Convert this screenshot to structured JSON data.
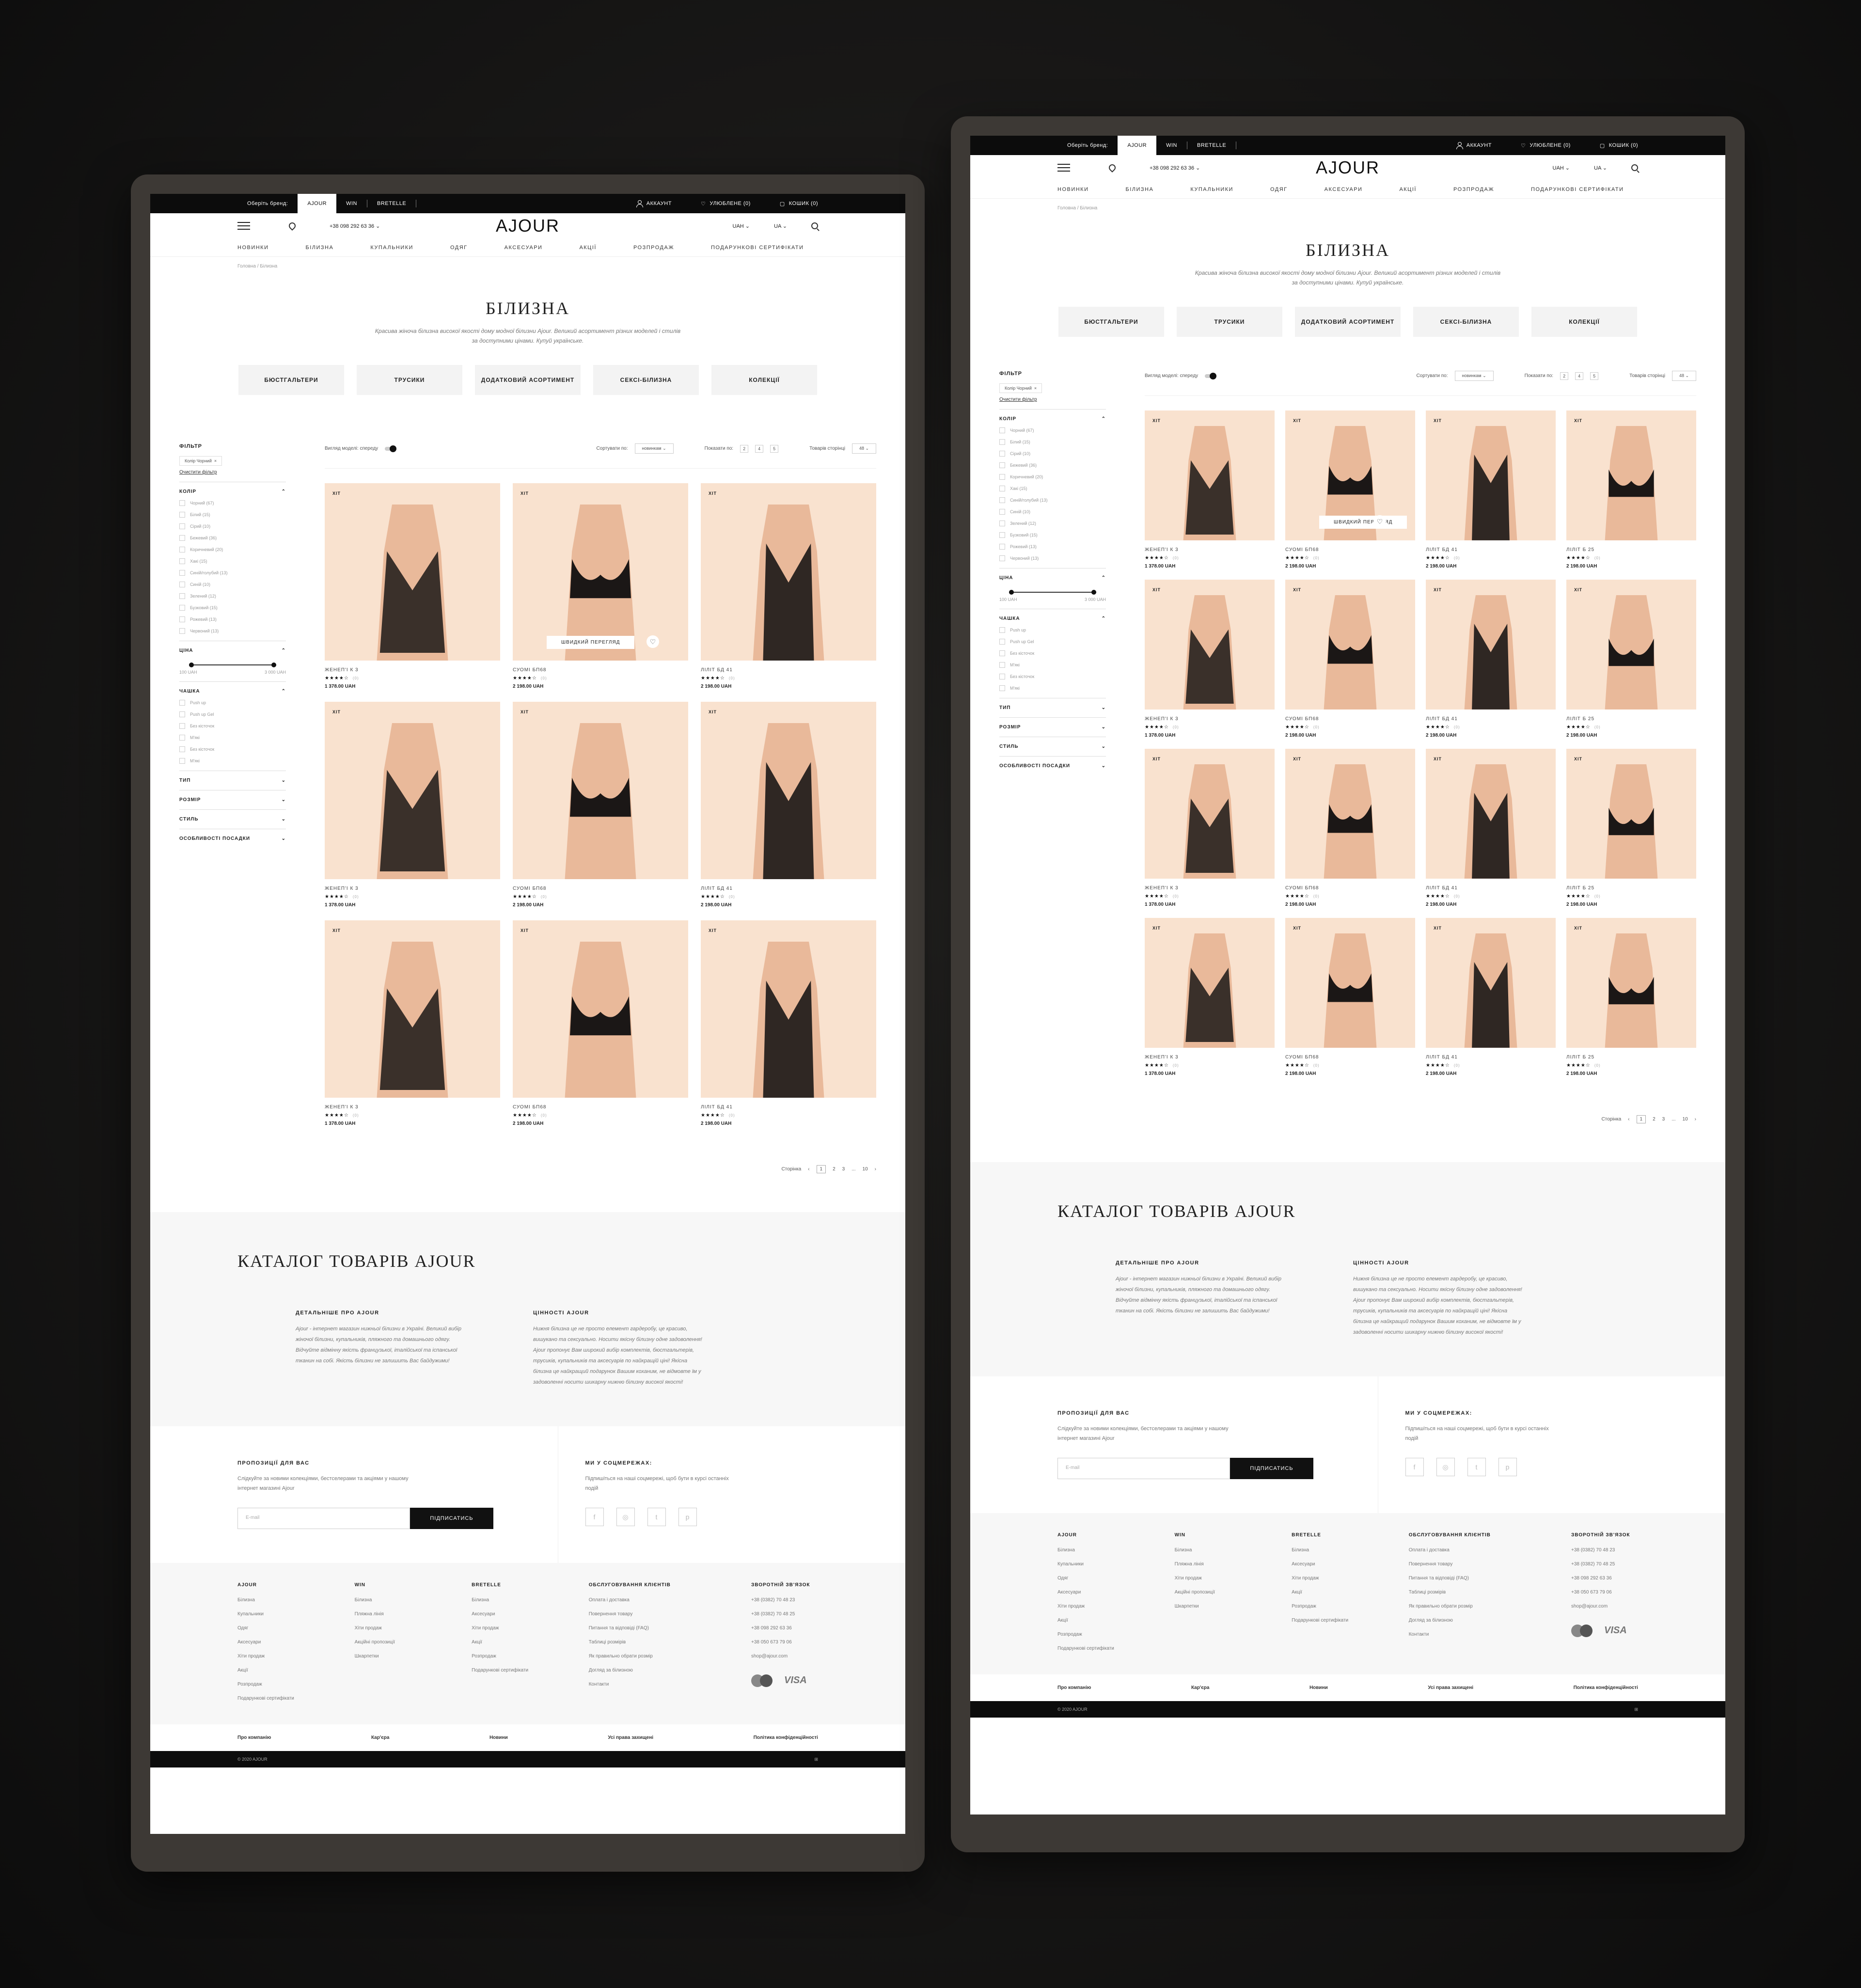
{
  "topbar": {
    "choose_brand": "Оберіть бренд:",
    "brands": [
      "AJOUR",
      "WIN",
      "BRETELLE"
    ],
    "account": "АККАУНТ",
    "favorites": "УЛЮБЛЕНЕ (0)",
    "cart": "КОШИК (0)"
  },
  "header": {
    "phone": "+38 098 292 63 36",
    "logo": "AJOUR",
    "currency": "UAH",
    "lang": "UA"
  },
  "nav": [
    "НОВИНКИ",
    "БІЛИЗНА",
    "КУПАЛЬНИКИ",
    "ОДЯГ",
    "АКСЕСУАРИ",
    "АКЦІЇ",
    "РОЗПРОДАЖ",
    "ПОДАРУНКОВІ СЕРТИФІКАТИ"
  ],
  "breadcrumb": "Головна / Білизна",
  "page": {
    "title": "БІЛИЗНА",
    "subtitle": "Красива жіноча білизна високої якості дому модної білизни Ajour. Великий асортимент різних моделей і стилів за доступними цінами. Купуй українське."
  },
  "categories": [
    "БЮСТГАЛЬТЕРИ",
    "ТРУСИКИ",
    "ДОДАТКОВИЙ АСОРТИМЕНТ",
    "СЕКСІ-БІЛИЗНА",
    "КОЛЕКЦІЇ"
  ],
  "filter": {
    "title": "ФІЛЬТР",
    "chip": "Колір Чорний",
    "clear": "Очистити фільтр",
    "color_title": "КОЛІР",
    "colors": [
      "Чорний (67)",
      "Білий (15)",
      "Сірий (10)",
      "Бежевий (36)",
      "Коричневий (20)",
      "Хакі (15)",
      "Синій/голубий (13)",
      "Синій (10)",
      "Зелений (12)",
      "Бузковий (15)",
      "Рожевий (13)",
      "Червоний (13)"
    ],
    "price_title": "ЦІНА",
    "price_min": "100 UAH",
    "price_max": "3 000 UAH",
    "cup_title": "ЧАШКА",
    "cups": [
      "Push up",
      "Push up Gel",
      "Без кісточок",
      "М'які",
      "Без кісточок",
      "М'які"
    ],
    "more": [
      "ТИП",
      "РОЗМІР",
      "СТИЛЬ",
      "ОСОБЛИВОСТІ ПОСАДКИ"
    ]
  },
  "toolbar": {
    "view": "Вигляд моделі: спереду",
    "sort_label": "Сортувати по:",
    "sort_value": "новинкам",
    "show_label": "Показати по:",
    "show_options": [
      "2",
      "4",
      "5"
    ],
    "per_page_label": "Товарів сторінці",
    "per_page_value": "48"
  },
  "product_common": {
    "badge": "ХІТ",
    "quick_view": "ШВИДКИЙ ПЕРЕГЛЯД"
  },
  "products": [
    {
      "name": "ЖЕНЕП'І К 3",
      "stars": "★★★★☆",
      "reviews": "(0)",
      "price": "1 378.00 UAH"
    },
    {
      "name": "СУОМІ БП68",
      "stars": "★★★★☆",
      "reviews": "(0)",
      "price": "2 198.00 UAH"
    },
    {
      "name": "ЛІЛІТ БД 41",
      "stars": "★★★★☆",
      "reviews": "(0)",
      "price": "2 198.00 UAH"
    },
    {
      "name": "ЛІЛІТ Б 25",
      "stars": "★★★★☆",
      "reviews": "(0)",
      "price": "2 198.00 UAH"
    }
  ],
  "pager": {
    "label": "Сторінка",
    "pages": [
      "1",
      "2",
      "3",
      "...",
      "10"
    ],
    "next": "›",
    "prev": "‹"
  },
  "catalog": {
    "title": "КАТАЛОГ ТОВАРІВ AJOUR",
    "about_title": "ДЕТАЛЬНІШЕ ПРО AJOUR",
    "about_text": "Ajour - інтернет магазин нижньої білизни в Україні. Великий вибір жіночої білизни, купальників, пляжного та домашнього одягу. Відчуйте відмінну якість французької, італійської та іспанської тканин на собі. Якість білизни не залишить Вас байдужими!",
    "values_title": "ЦІННОСТІ AJOUR",
    "values_text": "Нижня білизна це не просто елемент гардеробу, це красиво, вишукано та сексуально. Носити якісну білизну одне задоволення! Ajour пропонує Вам широкий вибір комплектів, бюстгальтерів, трусиків, купальників та аксесуарів по найкращій ціні! Якісна білизна це найкращий подарунок Вашим коханим, не відмовте їм у задоволенні носити шикарну нижню білизну високої якості!"
  },
  "subscribe": {
    "title": "ПРОПОЗИЦІЇ ДЛЯ ВАС",
    "text": "Слідкуйте за новими колекціями, бестселерами та акціями у нашому інтернет магазині Ajour",
    "placeholder": "E-mail",
    "button": "ПІДПИСАТИСЬ",
    "social_title": "МИ У СОЦМЕРЕЖАХ:",
    "social_text": "Підпишіться на наші соцмережі, щоб бути в курсі останніх подій",
    "social_icons": [
      "f",
      "◎",
      "t",
      "p"
    ]
  },
  "footer": {
    "cols": [
      {
        "title": "AJOUR",
        "items": [
          "Білизна",
          "Купальники",
          "Одяг",
          "Аксесуари",
          "Хіти продаж",
          "Акції",
          "Розпродаж",
          "Подарункові сертифікати"
        ]
      },
      {
        "title": "WIN",
        "items": [
          "Білизна",
          "Пляжна лінія",
          "Хіти продаж",
          "Акційні пропозиції",
          "Шкарпетки"
        ]
      },
      {
        "title": "BRETELLE",
        "items": [
          "Білизна",
          "Аксесуари",
          "Хіти продаж",
          "Акції",
          "Розпродаж",
          "Подарункові сертифікати"
        ]
      },
      {
        "title": "ОБСЛУГОВУВАННЯ КЛІЄНТІВ",
        "items": [
          "Оплата і доставка",
          "Повернення товару",
          "Питання та відповіді (FAQ)",
          "Таблиці розмірів",
          "Як правильно обрати розмір",
          "Догляд за білизною",
          "Контакти"
        ]
      },
      {
        "title": "ЗВОРОТНІЙ ЗВ'ЯЗОК",
        "items": [
          "+38 (0382) 70 48 23",
          "+38 (0382) 70 48 25",
          "+38 098 292 63 36",
          "+38 050 673 79 06",
          "shop@ajour.com"
        ]
      }
    ],
    "visa": "VISA",
    "bottom": [
      "Про компанію",
      "Кар'єра",
      "Новини",
      "Усі права захищені",
      "Політика конфіденційності"
    ],
    "copyright": "© 2020 AJOUR"
  }
}
